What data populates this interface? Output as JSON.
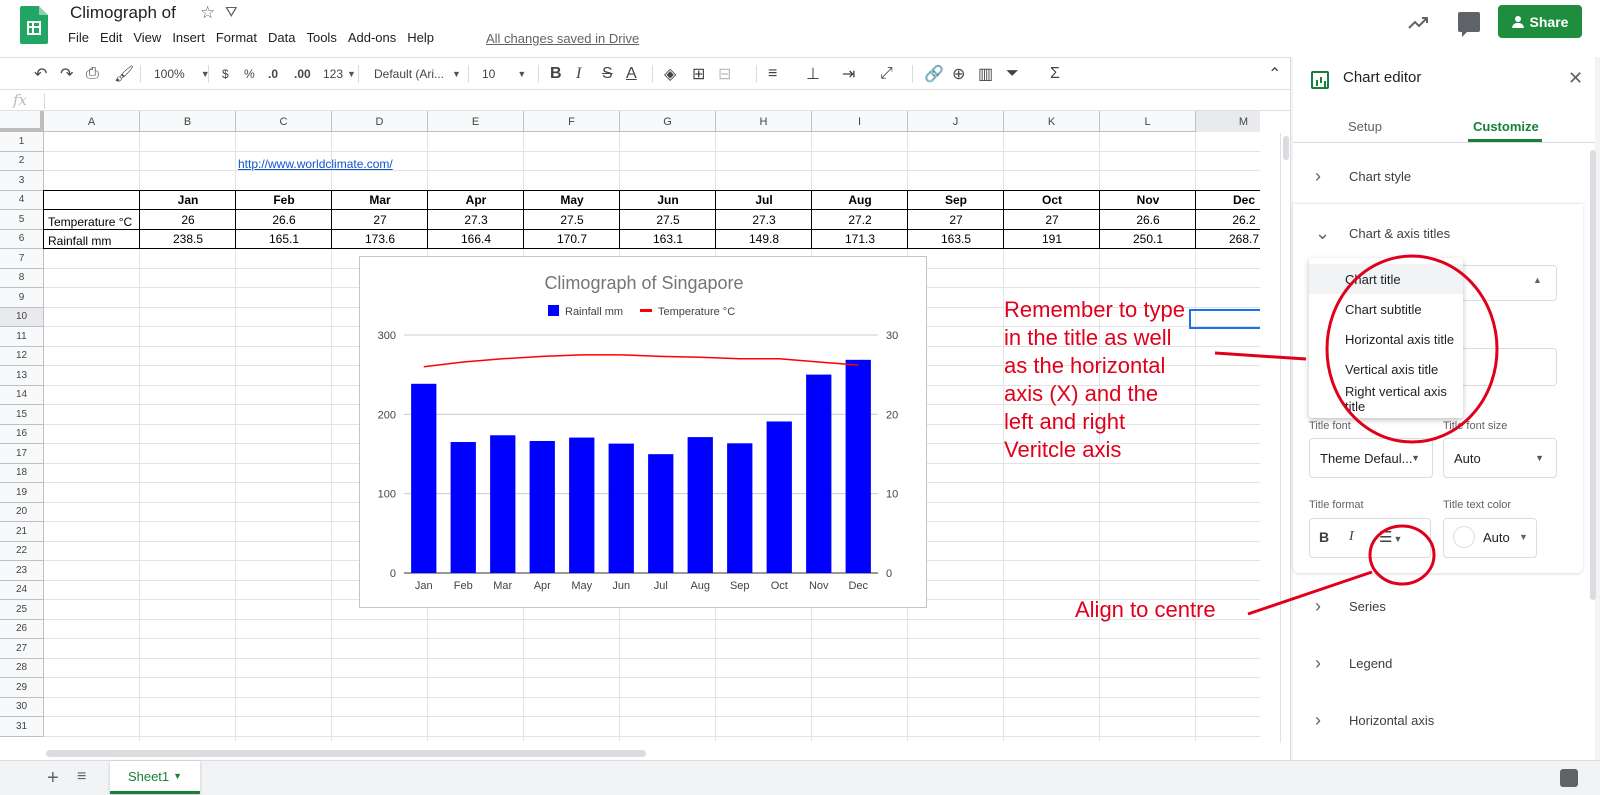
{
  "doc": {
    "title": "Climograph of",
    "saved_status": "All changes saved in Drive",
    "share_label": "Share",
    "icons": [
      "sheets-logo-icon",
      "star-icon",
      "drive-move-icon",
      "trending-icon",
      "comment-icon"
    ]
  },
  "menu": [
    "File",
    "Edit",
    "View",
    "Insert",
    "Format",
    "Data",
    "Tools",
    "Add-ons",
    "Help"
  ],
  "toolbar": {
    "zoom": "100%",
    "currency": "$",
    "percent": "%",
    "dec_less": ".0",
    "dec_more": ".00",
    "format_more": "123",
    "font": "Default (Ari...",
    "font_size": "10"
  },
  "formula_bar": {
    "icon": "fx",
    "value": ""
  },
  "columns": [
    "A",
    "B",
    "C",
    "D",
    "E",
    "F",
    "G",
    "H",
    "I",
    "J",
    "K",
    "L",
    "M"
  ],
  "rows": [
    "1",
    "2",
    "3",
    "4",
    "5",
    "6",
    "7",
    "8",
    "9",
    "10",
    "11",
    "12",
    "13",
    "14",
    "15",
    "16",
    "17",
    "18",
    "19",
    "20",
    "21",
    "22",
    "23",
    "24",
    "25",
    "26",
    "27",
    "28",
    "29",
    "30",
    "31"
  ],
  "sheet": {
    "link": "http://www.worldclimate.com/",
    "header": [
      "Jan",
      "Feb",
      "Mar",
      "Apr",
      "May",
      "Jun",
      "Jul",
      "Aug",
      "Sep",
      "Oct",
      "Nov",
      "Dec"
    ],
    "temp_label": "Temperature °C",
    "temp": [
      "26",
      "26.6",
      "27",
      "27.3",
      "27.5",
      "27.5",
      "27.3",
      "27.2",
      "27",
      "27",
      "26.6",
      "26.2"
    ],
    "rain_label": "Rainfall mm",
    "rain": [
      "238.5",
      "165.1",
      "173.6",
      "166.4",
      "170.7",
      "163.1",
      "149.8",
      "171.3",
      "163.5",
      "191",
      "250.1",
      "268.7"
    ]
  },
  "chart_data": {
    "type": "bar",
    "title": "Climograph of Singapore",
    "categories": [
      "Jan",
      "Feb",
      "Mar",
      "Apr",
      "May",
      "Jun",
      "Jul",
      "Aug",
      "Sep",
      "Oct",
      "Nov",
      "Dec"
    ],
    "series": [
      {
        "name": "Rainfall mm",
        "kind": "bar",
        "axis": "left",
        "color": "#0000ff",
        "values": [
          238.5,
          165.1,
          173.6,
          166.4,
          170.7,
          163.1,
          149.8,
          171.3,
          163.5,
          191,
          250.1,
          268.7
        ]
      },
      {
        "name": "Temperature °C",
        "kind": "line",
        "axis": "right",
        "color": "#ff0000",
        "values": [
          26,
          26.6,
          27,
          27.3,
          27.5,
          27.5,
          27.3,
          27.2,
          27,
          27,
          26.6,
          26.2
        ]
      }
    ],
    "ylim_left": [
      0,
      300
    ],
    "ylim_right": [
      0,
      30
    ],
    "yticks_left": [
      "0",
      "100",
      "200",
      "300"
    ],
    "yticks_right": [
      "0",
      "10",
      "20",
      "30"
    ],
    "legend": "top",
    "grid": true
  },
  "sheet_tabs": [
    {
      "label": "Sheet1"
    }
  ],
  "panel": {
    "title": "Chart editor",
    "tabs": {
      "setup": "Setup",
      "customize": "Customize"
    },
    "sections": [
      "Chart style",
      "Chart & axis titles",
      "Series",
      "Legend",
      "Horizontal axis"
    ],
    "dropdown": [
      "Chart title",
      "Chart subtitle",
      "Horizontal axis title",
      "Vertical axis title",
      "Right vertical axis title"
    ],
    "title_font_label": "Title font",
    "title_font_value": "Theme Defaul...",
    "title_size_label": "Title font size",
    "title_size_value": "Auto",
    "title_format_label": "Title format",
    "title_color_label": "Title text color",
    "title_color_value": "Auto",
    "bold": "B",
    "italic": "I"
  },
  "annotations": {
    "note1": [
      "Remember to type",
      "in the title as well",
      "as the horizontal",
      "axis (X) and the",
      "left and right",
      "Veritcle axis"
    ],
    "note2": "Align to centre",
    "color": "#e0001b"
  }
}
